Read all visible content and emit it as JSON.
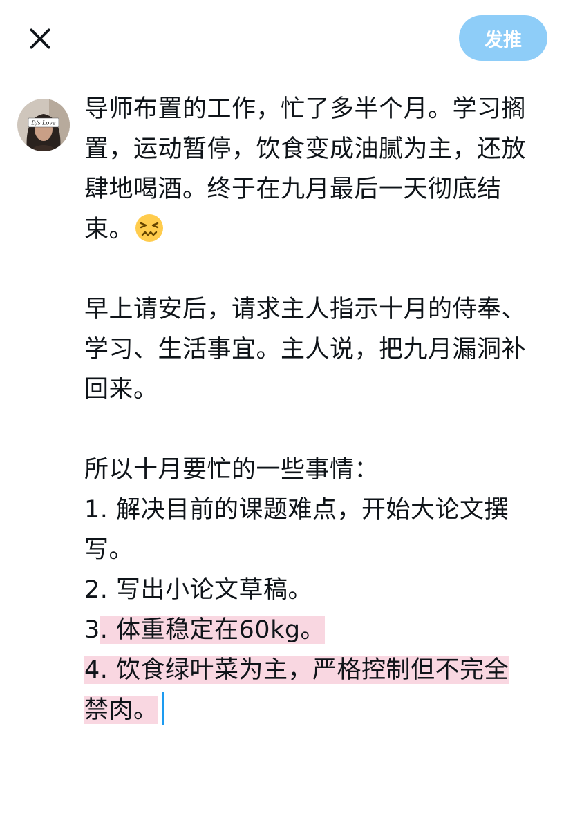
{
  "header": {
    "close_icon": "close-icon",
    "tweet_button_label": "发推",
    "accent_color": "#8ecdf8"
  },
  "avatar": {
    "badge_text": "D/s Love"
  },
  "composer": {
    "highlight_color": "#f9d7e1",
    "caret_color": "#1d9bf0",
    "emoji": "confounded-face-emoji",
    "paragraph1": [
      "导师布置的工作，忙了多半个月。学习搁",
      "置，运动暂停，饮食变成油腻为主，还放",
      "肆地喝酒。终于在九月最后一天彻底结",
      "束。"
    ],
    "paragraph2": [
      "早上请安后，请求主人指示十月的侍奉、",
      "学习、生活事宜。主人说，把九月漏洞补",
      "回来。"
    ],
    "paragraph3": {
      "intro": "所以十月要忙的一些事情：",
      "item1_line1": "1. 解决目前的课题难点，开始大论文撰",
      "item1_line2": "写。",
      "item2": "2. 写出小论文草稿。",
      "item3_prefix": "3",
      "item3_highlighted": ". 体重稳定在60kg。",
      "item4_line1": "4. 饮食绿叶菜为主，严格控制但不完全",
      "item4_line2": "禁肉。"
    }
  }
}
